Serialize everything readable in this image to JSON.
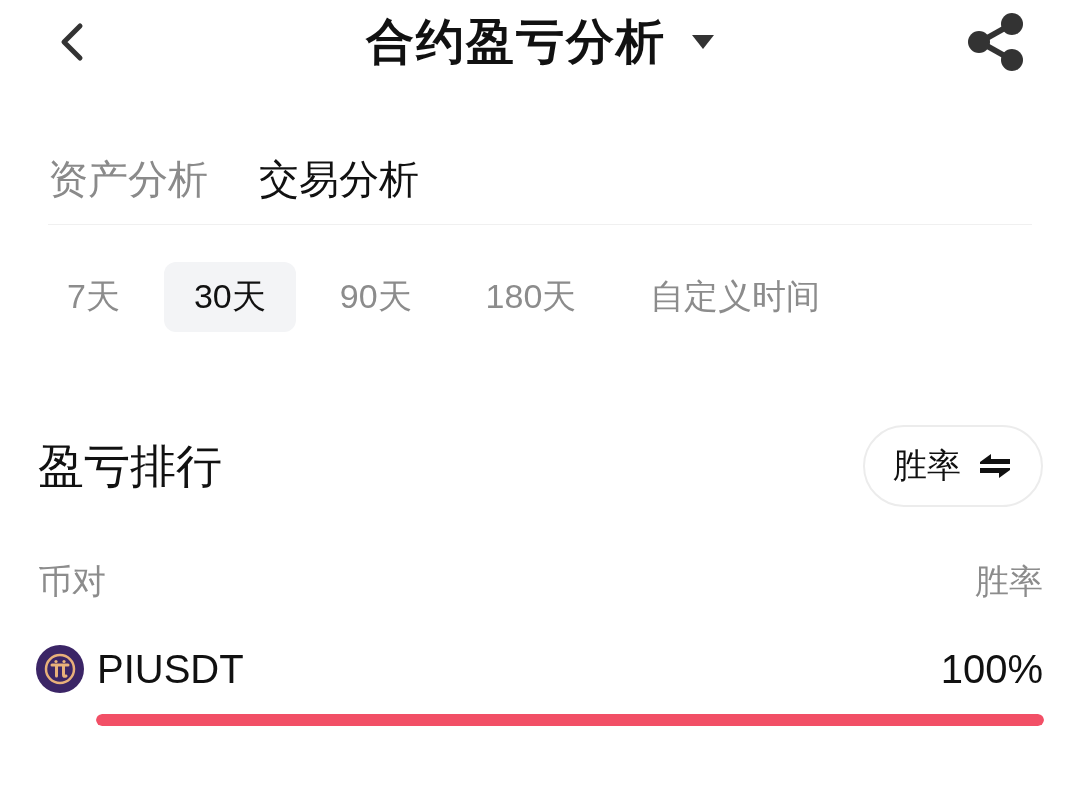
{
  "header": {
    "title": "合约盈亏分析"
  },
  "tabs": [
    {
      "label": "资产分析",
      "selected": false
    },
    {
      "label": "交易分析",
      "selected": true
    }
  ],
  "periods": [
    {
      "label": "7天",
      "selected": false
    },
    {
      "label": "30天",
      "selected": true
    },
    {
      "label": "90天",
      "selected": false
    },
    {
      "label": "180天",
      "selected": false
    },
    {
      "label": "自定义时间",
      "selected": false
    }
  ],
  "ranking": {
    "title": "盈亏排行",
    "sort_button": {
      "label": "胜率"
    },
    "columns": [
      "币对",
      "胜率"
    ],
    "rows": [
      {
        "pair": "PIUSDT",
        "value": "100%",
        "level": 1
      }
    ]
  }
}
